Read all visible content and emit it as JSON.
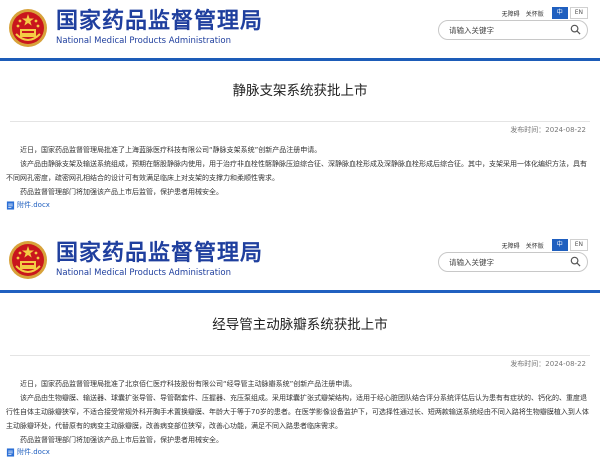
{
  "colors": {
    "brand_blue": "#1f3f9e",
    "accent_blue": "#1d5cb8",
    "link_blue": "#1f5fbf"
  },
  "articles": [
    {
      "header": {
        "site_name_cn": "国家药品监督管理局",
        "site_name_en": "National Medical Products Administration",
        "accessibility": "无障碍",
        "care_mode": "关怀版",
        "lang_cn": "中",
        "lang_en": "EN",
        "search_placeholder": "请输入关键字"
      },
      "title": "静脉支架系统获批上市",
      "date": "发布时间：2024-08-22",
      "paragraphs": [
        "近日，国家药品监督管理局批准了上海蓝脉医疗科技有限公司“静脉支架系统”创新产品注册申请。",
        "该产品由静脉支架及输送系统组成，预期在髂股静脉内使用，用于治疗非血栓性髂静脉压迫综合征、深静脉血栓形成及深静脉血栓形成后综合征。其中，支架采用一体化编织方法，具有不同网孔密度，疏密网孔相结合的设计可有效满足临床上对支架的支撑力和柔顺性需求。",
        "药品监督管理部门将加强该产品上市后监管，保护患者用械安全。"
      ],
      "attachment": "附件.docx"
    },
    {
      "header": {
        "site_name_cn": "国家药品监督管理局",
        "site_name_en": "National Medical Products Administration",
        "accessibility": "无障碍",
        "care_mode": "关怀版",
        "lang_cn": "中",
        "lang_en": "EN",
        "search_placeholder": "请输入关键字"
      },
      "title": "经导管主动脉瓣系统获批上市",
      "date": "发布时间：2024-08-22",
      "paragraphs": [
        "近日，国家药品监督管理局批准了北京佰仁医疗科技股份有限公司“经导管主动脉瓣系统”创新产品注册申请。",
        "该产品由生物瓣膜、输送器、球囊扩张导管、导管鞘套件、压握器、充压泵组成。采用球囊扩张式瓣架结构，适用于经心脏团队结合评分系统评估后认为患有有症状的、钙化的、重度退行性自体主动脉瓣狭窄，不适合接受常规外科开胸手术置换瓣膜、年龄大于等于70岁的患者。在医学影像设备监护下，可选择性通过长、短两款输送系统经由不同入路将生物瓣膜植入到人体主动脉瓣环处，代替原有的病变主动脉瓣膜，改善病变部位狭窄，改善心功能，满足不同入路患者临床需求。",
        "药品监督管理部门将加强该产品上市后监管，保护患者用械安全。"
      ],
      "attachment": "附件.docx"
    }
  ]
}
